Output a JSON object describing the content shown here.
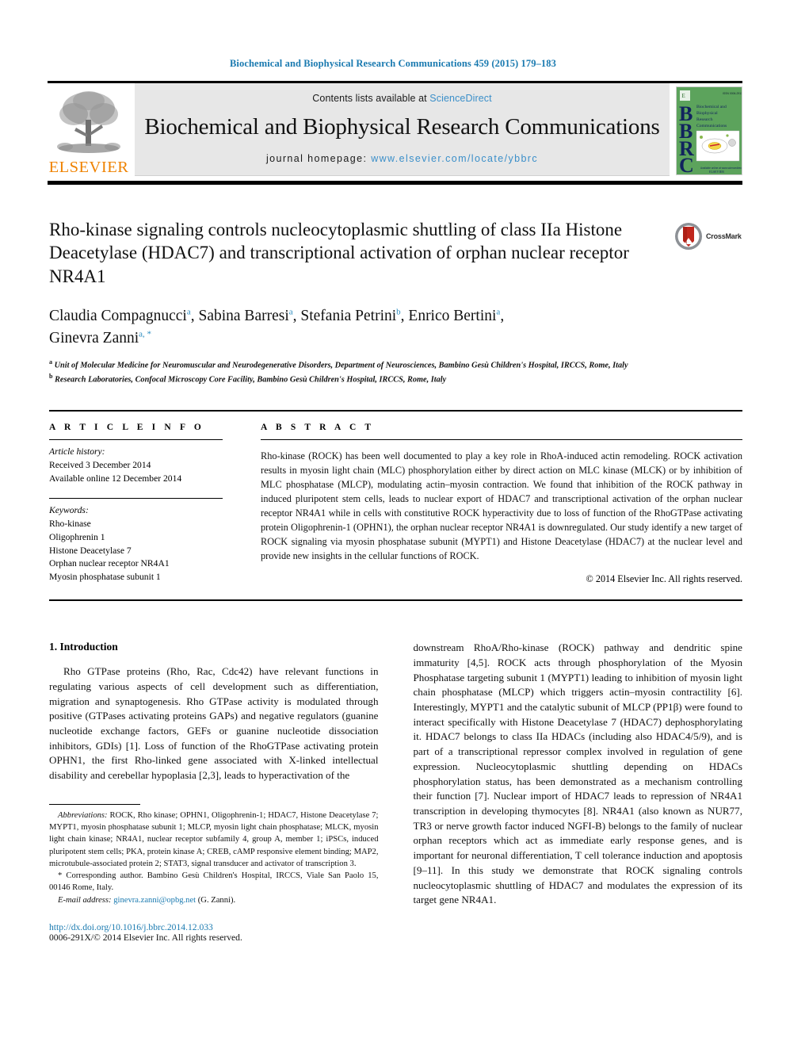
{
  "running_head": "Biochemical and Biophysical Research Communications 459 (2015) 179–183",
  "masthead": {
    "publisher_name": "ELSEVIER",
    "contents_prefix": "Contents lists available at ",
    "contents_link": "ScienceDirect",
    "journal_title": "Biochemical and Biophysical Research Communications",
    "homepage_prefix": "journal homepage: ",
    "homepage_url": "www.elsevier.com/locate/ybbrc",
    "cover": {
      "letters": [
        "B",
        "B",
        "R",
        "C"
      ],
      "title_lines": [
        "Biochemical and",
        "Biophysical",
        "Research",
        "Communications"
      ],
      "footer": "ELSEVIER",
      "bg_color": "#5ca35c"
    }
  },
  "article": {
    "title": "Rho-kinase signaling controls nucleocytoplasmic shuttling of class IIa Histone Deacetylase (HDAC7) and transcriptional activation of orphan nuclear receptor NR4A1",
    "crossmark_label": "CrossMark",
    "authors": [
      {
        "name": "Claudia Compagnucci",
        "marks": "a",
        "sep": ", "
      },
      {
        "name": "Sabina Barresi",
        "marks": "a",
        "sep": ", "
      },
      {
        "name": "Stefania Petrini",
        "marks": "b",
        "sep": ", "
      },
      {
        "name": "Enrico Bertini",
        "marks": "a",
        "sep": ", "
      },
      {
        "name": "Ginevra Zanni",
        "marks": "a, *",
        "sep": ""
      }
    ],
    "affiliations": [
      {
        "mark": "a",
        "text": "Unit of Molecular Medicine for Neuromuscular and Neurodegenerative Disorders, Department of Neurosciences, Bambino Gesù Children's Hospital, IRCCS, Rome, Italy"
      },
      {
        "mark": "b",
        "text": "Research Laboratories, Confocal Microscopy Core Facility, Bambino Gesù Children's Hospital, IRCCS, Rome, Italy"
      }
    ]
  },
  "article_info": {
    "heading": "A R T I C L E   I N F O",
    "history_label": "Article history:",
    "history": [
      "Received 3 December 2014",
      "Available online 12 December 2014"
    ],
    "keywords_label": "Keywords:",
    "keywords": [
      "Rho-kinase",
      "Oligophrenin 1",
      "Histone Deacetylase 7",
      "Orphan nuclear receptor NR4A1",
      "Myosin phosphatase subunit 1"
    ]
  },
  "abstract": {
    "heading": "A B S T R A C T",
    "text": "Rho-kinase (ROCK) has been well documented to play a key role in RhoA-induced actin remodeling. ROCK activation results in myosin light chain (MLC) phosphorylation either by direct action on MLC kinase (MLCK) or by inhibition of MLC phosphatase (MLCP), modulating actin–myosin contraction. We found that inhibition of the ROCK pathway in induced pluripotent stem cells, leads to nuclear export of HDAC7 and transcriptional activation of the orphan nuclear receptor NR4A1 while in cells with constitutive ROCK hyperactivity due to loss of function of the RhoGTPase activating protein Oligophrenin-1 (OPHN1), the orphan nuclear receptor NR4A1 is downregulated. Our study identify a new target of ROCK signaling via myosin phosphatase subunit (MYPT1) and Histone Deacetylase (HDAC7) at the nuclear level and provide new insights in the cellular functions of ROCK.",
    "copyright": "© 2014 Elsevier Inc. All rights reserved."
  },
  "introduction": {
    "section_number_title": "1.  Introduction",
    "paragraph_left": "Rho GTPase proteins (Rho, Rac, Cdc42) have relevant functions in regulating various aspects of cell development such as differentiation, migration and synaptogenesis. Rho GTPase activity is modulated through positive (GTPases activating proteins GAPs) and negative regulators (guanine nucleotide exchange factors, GEFs or guanine nucleotide dissociation inhibitors, GDIs) [1]. Loss of function of the RhoGTPase activating protein OPHN1, the first Rho-linked gene associated with X-linked intellectual disability and cerebellar hypoplasia [2,3], leads to hyperactivation of the",
    "paragraph_right": "downstream RhoA/Rho-kinase (ROCK) pathway and dendritic spine immaturity [4,5]. ROCK acts through phosphorylation of the Myosin Phosphatase targeting subunit 1 (MYPT1) leading to inhibition of myosin light chain phosphatase (MLCP) which triggers actin–myosin contractility [6]. Interestingly, MYPT1 and the catalytic subunit of MLCP (PP1β) were found to interact specifically with Histone Deacetylase 7 (HDAC7) dephosphorylating it. HDAC7 belongs to class IIa HDACs (including also HDAC4/5/9), and is part of a transcriptional repressor complex involved in regulation of gene expression. Nucleocytoplasmic shuttling depending on HDACs phosphorylation status, has been demonstrated as a mechanism controlling their function [7]. Nuclear import of HDAC7 leads to repression of NR4A1 transcription in developing thymocytes [8]. NR4A1 (also known as NUR77, TR3 or nerve growth factor induced NGFI-B) belongs to the family of nuclear orphan receptors which act as immediate early response genes, and is important for neuronal differentiation, T cell tolerance induction and apoptosis [9–11]. In this study we demonstrate that ROCK signaling controls nucleocytoplasmic shuttling of HDAC7 and modulates the expression of its target gene NR4A1."
  },
  "footnotes": {
    "abbreviations_label": "Abbreviations:",
    "abbreviations_text": " ROCK, Rho kinase; OPHN1, Oligophrenin-1; HDAC7, Histone Deacetylase 7; MYPT1, myosin phosphatase subunit 1; MLCP, myosin light chain phosphatase; MLCK, myosin light chain kinase; NR4A1, nuclear receptor subfamily 4, group A, member 1; iPSCs, induced pluripotent stem cells; PKA, protein kinase A; CREB, cAMP responsive element binding; MAP2, microtubule-associated protein 2; STAT3, signal transducer and activator of transcription 3.",
    "corresponding_author": "* Corresponding author. Bambino Gesù Children's Hospital, IRCCS, Viale San Paolo 15, 00146 Rome, Italy.",
    "email_label": "E-mail address:",
    "email": "ginevra.zanni@opbg.net",
    "email_suffix": " (G. Zanni)."
  },
  "footer": {
    "doi": "http://dx.doi.org/10.1016/j.bbrc.2014.12.033",
    "issn_copyright": "0006-291X/© 2014 Elsevier Inc. All rights reserved."
  },
  "colors": {
    "link_blue": "#1a7ab0",
    "sciencedirect_blue": "#3b8fc9",
    "elsevier_orange": "#ef8200",
    "cover_green": "#5ca35c"
  }
}
